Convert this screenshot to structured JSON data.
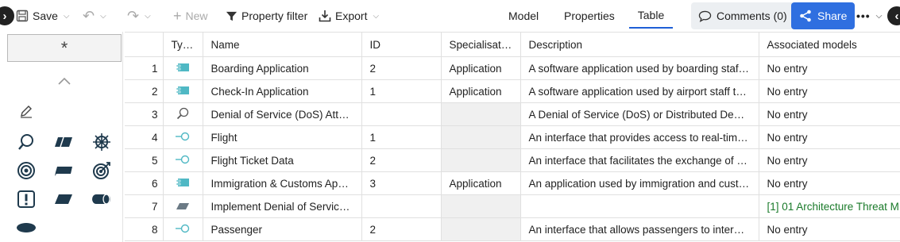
{
  "toolbar": {
    "save_label": "Save",
    "new_label": "New",
    "property_filter_label": "Property filter",
    "export_label": "Export",
    "views": [
      "Model",
      "Properties",
      "Table"
    ],
    "active_view": "Table",
    "comments_label": "Comments (0)",
    "share_label": "Share",
    "accent_color": "#2f6fe0"
  },
  "palette": {
    "star_label": "*",
    "icons": [
      "pencil-icon",
      "search-icon",
      "parallelogram-icon",
      "wheel-icon",
      "target-icon",
      "cloud-icon",
      "target-arrow-icon",
      "exclamation-icon",
      "parallelogram-filled-icon",
      "cylinder-icon",
      "ellipse-icon"
    ]
  },
  "table": {
    "columns": [
      "",
      "Type",
      "Name",
      "ID",
      "Specialisat…",
      "Description",
      "Associated models"
    ],
    "rows": [
      {
        "n": "1",
        "type": "application-component-icon",
        "name": "Boarding Application",
        "id": "2",
        "spec": "Application",
        "desc": "A software application used by boarding staff …",
        "assoc": "No entry"
      },
      {
        "n": "2",
        "type": "application-component-icon",
        "name": "Check-In Application",
        "id": "1",
        "spec": "Application",
        "desc": "A software application used by airport staff to …",
        "assoc": "No entry"
      },
      {
        "n": "3",
        "type": "search-icon",
        "name": "Denial of Service (DoS) Attack",
        "id": "",
        "spec": "",
        "desc": "A Denial of Service (DoS) or Distributed Deni…",
        "assoc": "No entry"
      },
      {
        "n": "4",
        "type": "interface-icon",
        "name": "Flight",
        "id": "1",
        "spec": "",
        "desc": "An interface that provides access to real-time …",
        "assoc": "No entry"
      },
      {
        "n": "5",
        "type": "interface-icon",
        "name": "Flight Ticket Data",
        "id": "2",
        "spec": "",
        "desc": "An interface that facilitates the exchange of fli…",
        "assoc": "No entry"
      },
      {
        "n": "6",
        "type": "application-component-icon",
        "name": "Immigration & Customs Appl…",
        "id": "3",
        "spec": "Application",
        "desc": "An application used by immigration and custo…",
        "assoc": "No entry"
      },
      {
        "n": "7",
        "type": "parallelogram-icon",
        "name": "Implement Denial of Service…",
        "id": "",
        "spec": "",
        "desc": "",
        "assoc": "[1] 01 Architecture Threat M"
      },
      {
        "n": "8",
        "type": "interface-icon",
        "name": "Passenger",
        "id": "2",
        "spec": "",
        "desc": "An interface that allows passengers to interac…",
        "assoc": "No entry"
      }
    ]
  }
}
